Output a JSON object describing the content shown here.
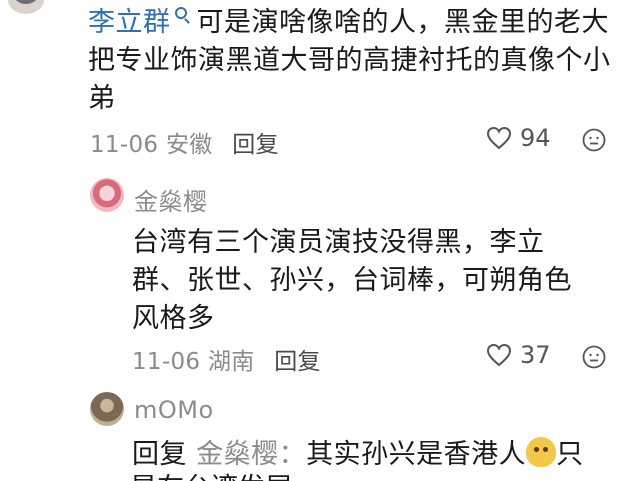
{
  "comment_main": {
    "username": "李立群",
    "text": "可是演啥像啥的人，黑金里的老大把专业饰演黑道大哥的高捷衬托的真像个小弟",
    "date": "11-06",
    "location": "安徽",
    "reply_label": "回复",
    "likes": "94"
  },
  "replies": [
    {
      "username": "金燊樱",
      "text": "台湾有三个演员演技没得黑，李立群、张世、孙兴，台词棒，可朔角色风格多",
      "date": "11-06",
      "location": "湖南",
      "reply_label": "回复",
      "likes": "37"
    },
    {
      "username": "mOMo",
      "reply_prefix": "回复",
      "reply_to": "金燊樱：",
      "text_before_sticker": "其实孙兴是香港人",
      "text_after_sticker": "只",
      "cut_text": "是在台湾发展。"
    }
  ],
  "icons": {
    "verify": "search-badge-icon",
    "heart": "heart-outline-icon",
    "emoji": "emoji-face-icon",
    "sticker": "mango-sticker-icon"
  },
  "colors": {
    "username_blue": "#2f6fb2",
    "meta_gray": "#8a8a8a"
  }
}
